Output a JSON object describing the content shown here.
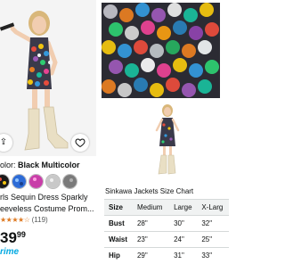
{
  "product": {
    "color_label": "olor:",
    "color_value": "Black Multicolor",
    "title_line1": "rls Sequin Dress Sparkly",
    "title_line2": "eeveless Costume Prom...",
    "stars": "★★★★☆",
    "rating_count": "(119)",
    "price_main": "39",
    "price_cents": "99",
    "prime_label": "rime",
    "swatch_colors": [
      "#1a1a1a",
      "#2d6bd6",
      "#c83ea8",
      "#c8c8c8",
      "#7a7a7a"
    ]
  },
  "size_chart": {
    "title": "Sinkawa Jackets Size Chart",
    "columns": [
      "Size",
      "Medium",
      "Large",
      "X-Larg"
    ],
    "rows": [
      {
        "label": "Bust",
        "values": [
          "28\"",
          "30\"",
          "32\""
        ]
      },
      {
        "label": "Waist",
        "values": [
          "23\"",
          "24\"",
          "25\""
        ]
      },
      {
        "label": "Hip",
        "values": [
          "29\"",
          "31\"",
          "33\""
        ]
      }
    ]
  },
  "icons": {
    "wishlist": "heart-icon",
    "share": "share-icon"
  }
}
